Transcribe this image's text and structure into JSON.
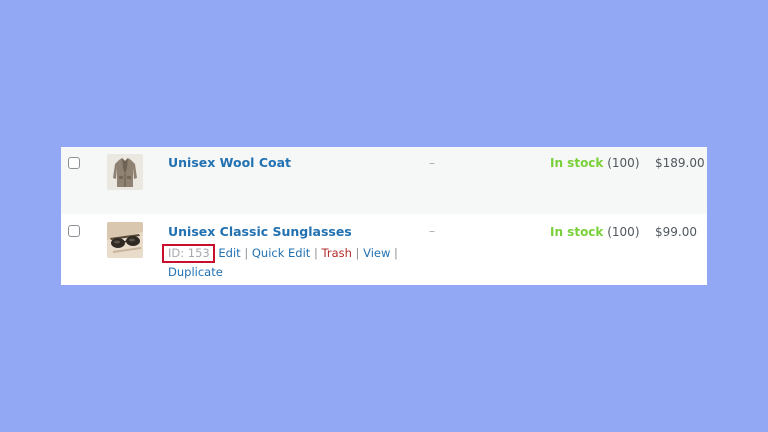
{
  "products": [
    {
      "name": "Unisex Wool Coat",
      "sku": "–",
      "stock_status": "In stock",
      "stock_qty": "(100)",
      "price": "$189.00",
      "thumbnail_icon": "wool-coat-thumbnail"
    },
    {
      "name": "Unisex Classic Sunglasses",
      "sku": "–",
      "stock_status": "In stock",
      "stock_qty": "(100)",
      "price": "$99.00",
      "thumbnail_icon": "sunglasses-thumbnail",
      "row_actions": {
        "id_label": "ID: 153",
        "separator": "|",
        "edit": "Edit",
        "quick_edit": "Quick Edit",
        "trash": "Trash",
        "view": "View",
        "duplicate": "Duplicate"
      }
    }
  ],
  "colors": {
    "background": "#93a8f4",
    "link": "#2271b1",
    "in_stock": "#7ad03a",
    "trash": "#b32d2e",
    "highlight_box": "#c8102e"
  }
}
